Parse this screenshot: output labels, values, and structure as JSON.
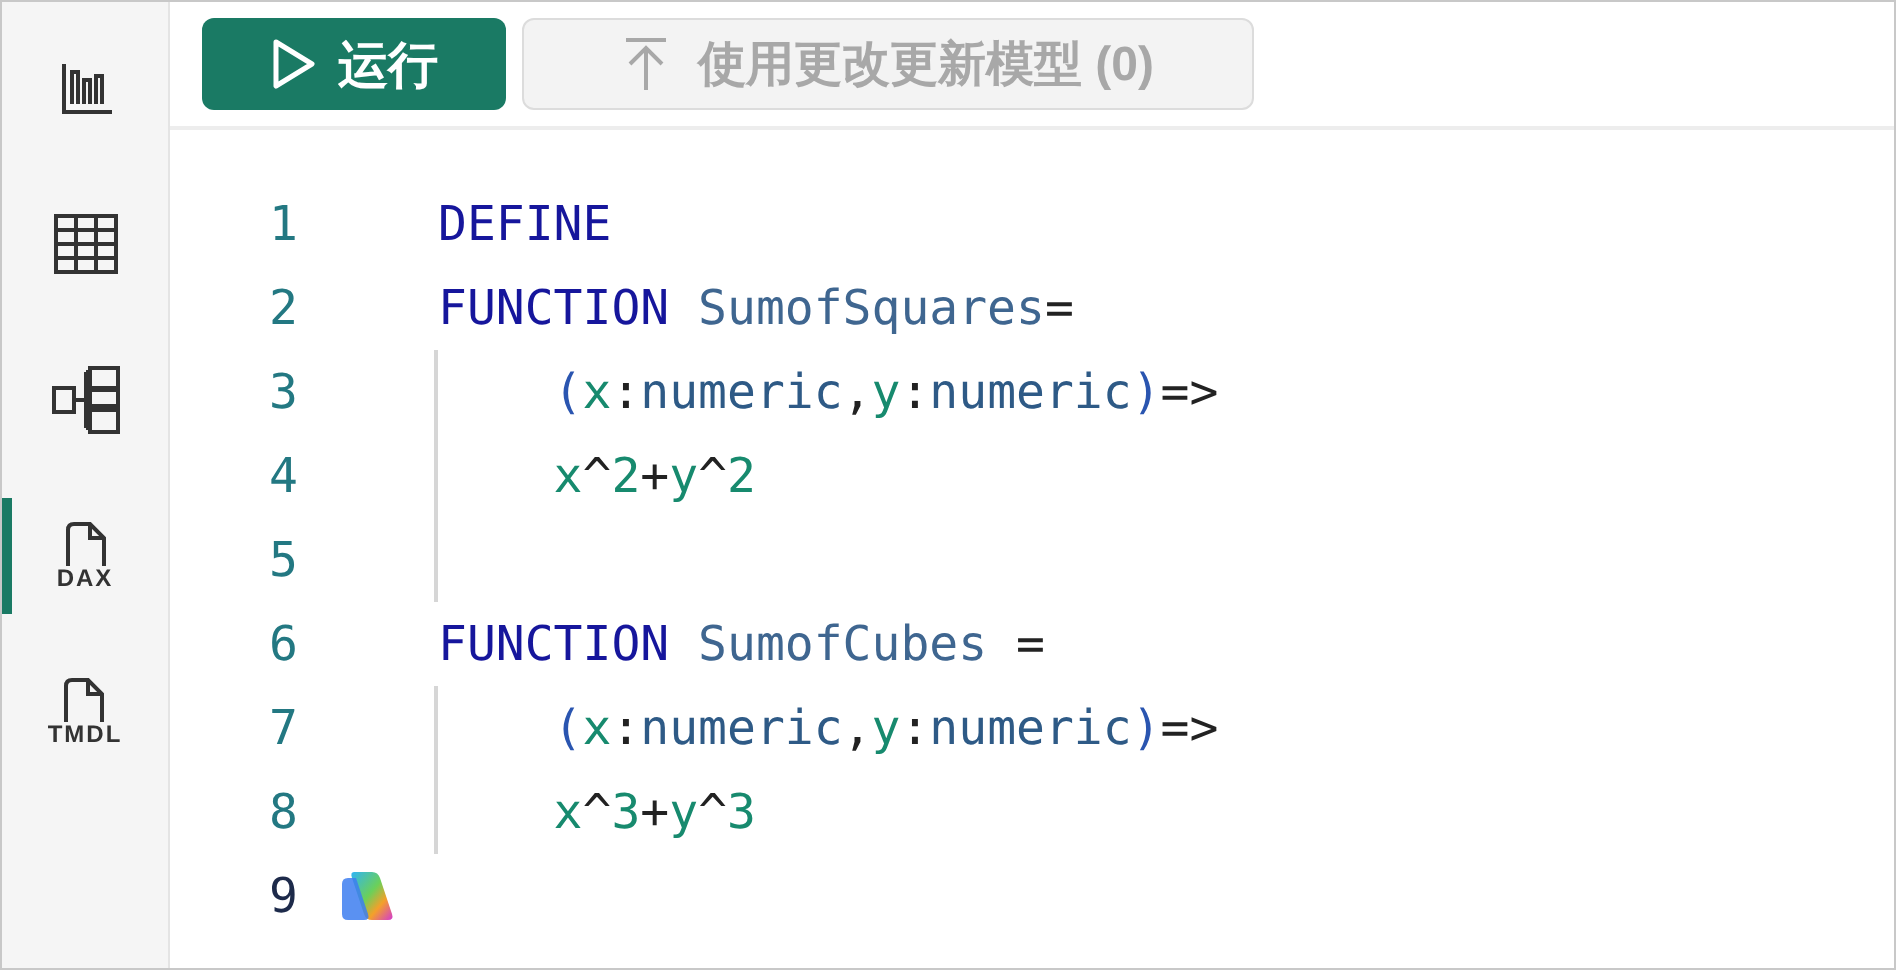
{
  "sidebar": {
    "items": [
      {
        "kind": "chart",
        "selected": false
      },
      {
        "kind": "table",
        "selected": false
      },
      {
        "kind": "model",
        "selected": false
      },
      {
        "kind": "doc",
        "label": "DAX",
        "selected": true
      },
      {
        "kind": "doc",
        "label": "TMDL",
        "selected": false
      }
    ]
  },
  "toolbar": {
    "run_button": {
      "label": "运行"
    },
    "update_button": {
      "label": "使用更改更新模型 (0)",
      "disabled": true
    }
  },
  "editor": {
    "lines": [
      {
        "number": "1",
        "active": false,
        "guide": false,
        "copilot": false,
        "tokens": [
          {
            "text": "DEFINE",
            "kind": "keyword"
          }
        ]
      },
      {
        "number": "2",
        "active": false,
        "guide": false,
        "copilot": false,
        "tokens": [
          {
            "text": "FUNCTION",
            "kind": "keyword"
          },
          {
            "text": " SumofSquares",
            "kind": "function"
          },
          {
            "text": "=",
            "kind": "plain"
          }
        ]
      },
      {
        "number": "3",
        "active": false,
        "guide": true,
        "copilot": false,
        "tokens": [
          {
            "text": "    (",
            "kind": "paren"
          },
          {
            "text": "x",
            "kind": "variable"
          },
          {
            "text": ":",
            "kind": "plain"
          },
          {
            "text": "numeric",
            "kind": "type"
          },
          {
            "text": ",",
            "kind": "plain"
          },
          {
            "text": "y",
            "kind": "variable"
          },
          {
            "text": ":",
            "kind": "plain"
          },
          {
            "text": "numeric",
            "kind": "type"
          },
          {
            "text": ")",
            "kind": "paren"
          },
          {
            "text": "=>",
            "kind": "plain"
          }
        ]
      },
      {
        "number": "4",
        "active": false,
        "guide": true,
        "copilot": false,
        "tokens": [
          {
            "text": "    x",
            "kind": "variable"
          },
          {
            "text": "^",
            "kind": "plain"
          },
          {
            "text": "2",
            "kind": "number"
          },
          {
            "text": "+",
            "kind": "plain"
          },
          {
            "text": "y",
            "kind": "variable"
          },
          {
            "text": "^",
            "kind": "plain"
          },
          {
            "text": "2",
            "kind": "number"
          }
        ]
      },
      {
        "number": "5",
        "active": false,
        "guide": true,
        "copilot": false
      },
      {
        "number": "6",
        "active": false,
        "guide": false,
        "copilot": false,
        "tokens": [
          {
            "text": "FUNCTION",
            "kind": "keyword"
          },
          {
            "text": " SumofCubes",
            "kind": "function"
          },
          {
            "text": " =",
            "kind": "plain"
          }
        ]
      },
      {
        "number": "7",
        "active": false,
        "guide": true,
        "copilot": false,
        "tokens": [
          {
            "text": "    (",
            "kind": "paren"
          },
          {
            "text": "x",
            "kind": "variable"
          },
          {
            "text": ":",
            "kind": "plain"
          },
          {
            "text": "numeric",
            "kind": "type"
          },
          {
            "text": ",",
            "kind": "plain"
          },
          {
            "text": "y",
            "kind": "variable"
          },
          {
            "text": ":",
            "kind": "plain"
          },
          {
            "text": "numeric",
            "kind": "type"
          },
          {
            "text": ")",
            "kind": "paren"
          },
          {
            "text": "=>",
            "kind": "plain"
          }
        ]
      },
      {
        "number": "8",
        "active": false,
        "guide": true,
        "copilot": false,
        "tokens": [
          {
            "text": "    x",
            "kind": "variable"
          },
          {
            "text": "^",
            "kind": "plain"
          },
          {
            "text": "3",
            "kind": "number"
          },
          {
            "text": "+",
            "kind": "plain"
          },
          {
            "text": "y",
            "kind": "variable"
          },
          {
            "text": "^",
            "kind": "plain"
          },
          {
            "text": "3",
            "kind": "number"
          }
        ]
      },
      {
        "number": "9",
        "active": true,
        "guide": false,
        "copilot": true
      }
    ]
  }
}
